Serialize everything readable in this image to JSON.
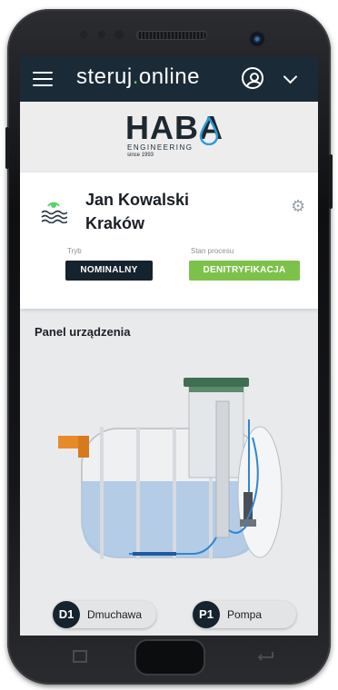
{
  "app": {
    "brand_prefix": "steruj",
    "brand_dot": ".",
    "brand_suffix": "online"
  },
  "logo": {
    "name": "HABA",
    "tagline": "ENGINEERING",
    "since": "since 1993"
  },
  "user": {
    "name": "Jan Kowalski",
    "city": "Kraków"
  },
  "status": {
    "mode_label": "Tryb",
    "mode_value": "NOMINALNY",
    "process_label": "Stan procesu",
    "process_value": "DENITRYFIKACJA"
  },
  "panel": {
    "title": "Panel urządzenia"
  },
  "devices": [
    {
      "code": "D1",
      "name": "Dmuchawa"
    },
    {
      "code": "P1",
      "name": "Pompa"
    }
  ],
  "colors": {
    "topbar": "#1a2a36",
    "mode_badge": "#15232e",
    "process_badge": "#7cc24a",
    "accent_green": "#5bd06a"
  },
  "icons": [
    "menu-icon",
    "user-icon",
    "chevron-down-icon",
    "wave-icon",
    "gear-icon",
    "back-icon",
    "recent-apps-icon"
  ]
}
